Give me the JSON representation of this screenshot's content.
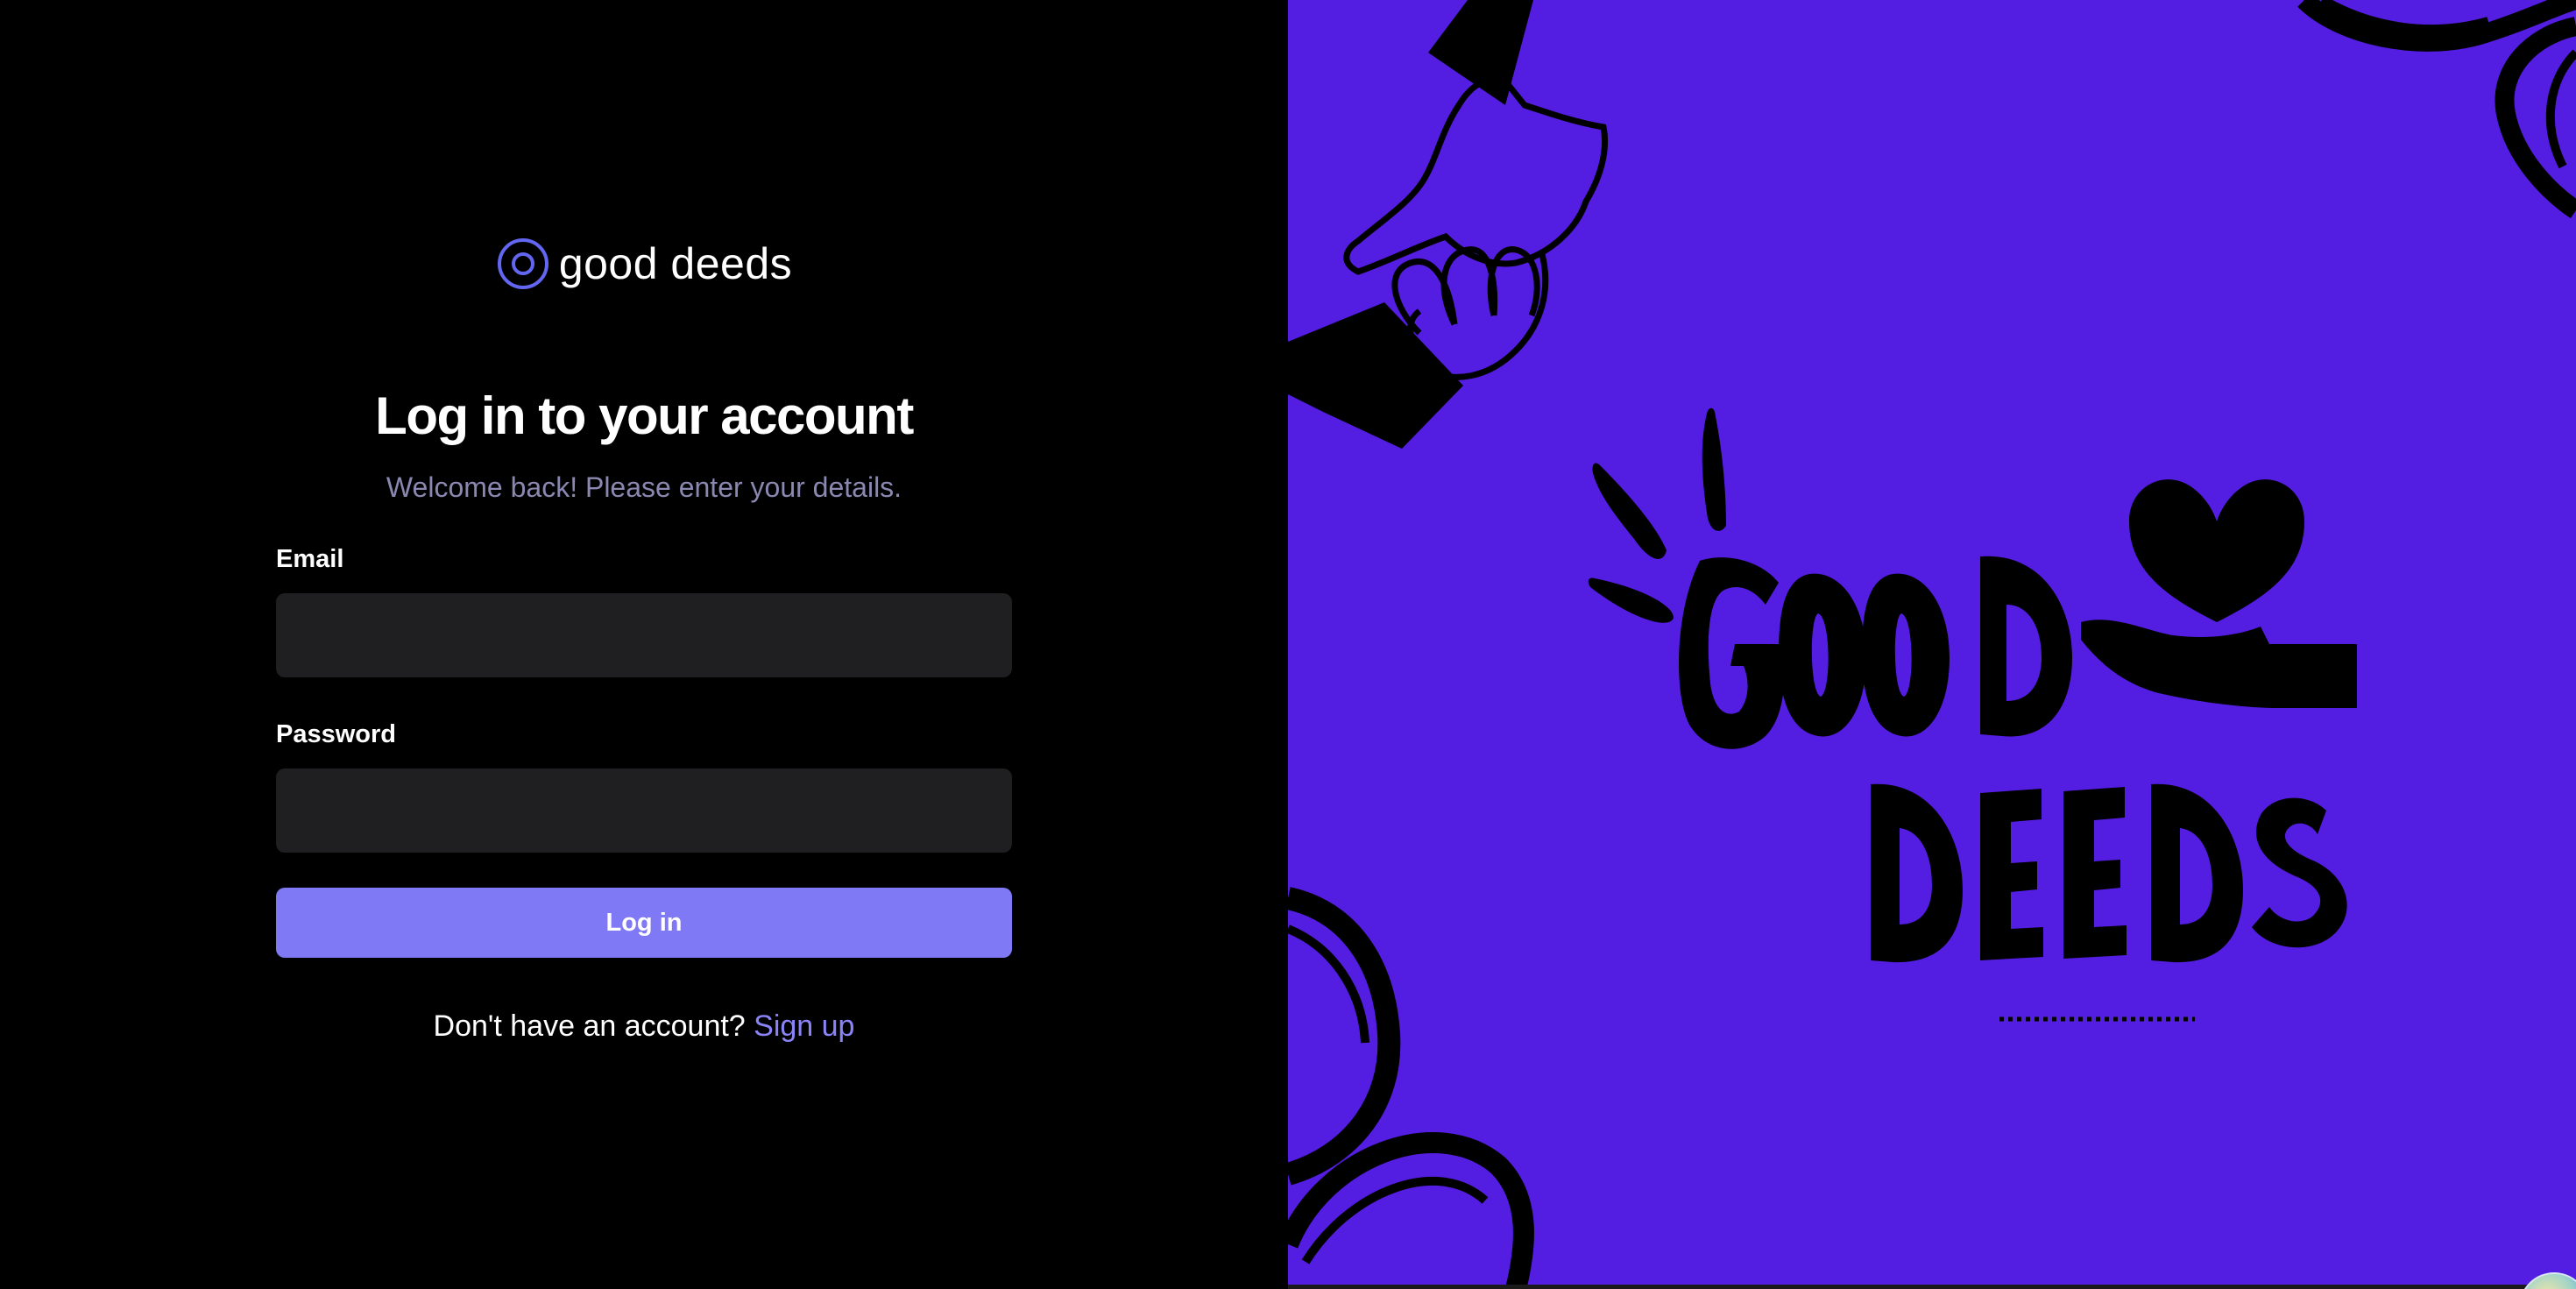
{
  "brand": {
    "name": "good deeds",
    "logo_icon": "circle-target-icon",
    "accent": "#6366f1"
  },
  "login": {
    "title": "Log in to your account",
    "subtitle": "Welcome back! Please enter your details.",
    "email_label": "Email",
    "email_value": "",
    "password_label": "Password",
    "password_value": "",
    "submit_label": "Log in",
    "signup_prompt": "Don't have an account?",
    "signup_link": "Sign up"
  },
  "hero": {
    "background": "#541de2",
    "lettering": "GOOD DEEDS",
    "icons": [
      "handshake-icon",
      "heart-in-hand-icon",
      "scribble-circle-icon"
    ]
  },
  "colors": {
    "button": "#8079f5",
    "link": "#8b84f7",
    "input_bg": "#1f1f21",
    "subtitle": "#8a88b0"
  }
}
